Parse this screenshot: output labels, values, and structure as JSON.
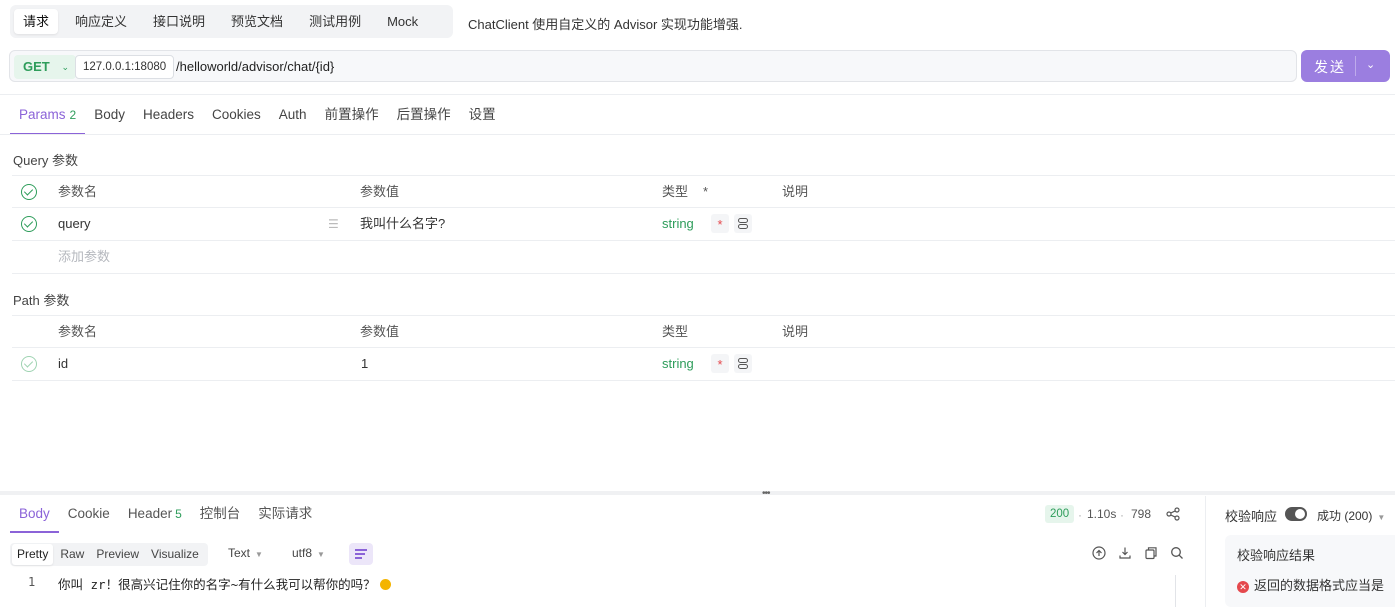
{
  "top_tabs": [
    "请求",
    "响应定义",
    "接口说明",
    "预览文档",
    "测试用例",
    "Mock"
  ],
  "description": "ChatClient 使用自定义的 Advisor 实现功能增强.",
  "request": {
    "method": "GET",
    "host": "127.0.0.1:18080",
    "path": "/helloworld/advisor/chat/{id}",
    "send_label": "发送"
  },
  "sub_tabs": [
    {
      "label": "Params",
      "badge": "2"
    },
    {
      "label": "Body"
    },
    {
      "label": "Headers"
    },
    {
      "label": "Cookies"
    },
    {
      "label": "Auth"
    },
    {
      "label": "前置操作"
    },
    {
      "label": "后置操作"
    },
    {
      "label": "设置"
    }
  ],
  "query": {
    "title": "Query 参数",
    "headers": {
      "name": "参数名",
      "value": "参数值",
      "type": "类型",
      "required": "*",
      "desc": "说明"
    },
    "rows": [
      {
        "name": "query",
        "value": "我叫什么名字?",
        "type": "string"
      }
    ],
    "add_placeholder": "添加参数"
  },
  "path_params": {
    "title": "Path 参数",
    "headers": {
      "name": "参数名",
      "value": "参数值",
      "type": "类型",
      "desc": "说明"
    },
    "rows": [
      {
        "name": "id",
        "value": "1",
        "type": "string"
      }
    ]
  },
  "response": {
    "tabs": [
      {
        "label": "Body"
      },
      {
        "label": "Cookie"
      },
      {
        "label": "Header",
        "badge": "5"
      },
      {
        "label": "控制台"
      },
      {
        "label": "实际请求"
      }
    ],
    "status": "200",
    "time": "1.10s",
    "size": "798",
    "formats": [
      "Pretty",
      "Raw",
      "Preview",
      "Visualize"
    ],
    "content_type": "Text",
    "encoding": "utf8",
    "line_number": "1",
    "body_text": "你叫 zr！很高兴记住你的名字~有什么我可以帮你的吗？"
  },
  "validation": {
    "label": "校验响应",
    "selected": "成功 (200)",
    "result_title": "校验响应结果",
    "error_text": "返回的数据格式应当是"
  },
  "colors": {
    "accent": "#8b63d8",
    "send_button": "#9b7ee0",
    "success": "#2e9d5b",
    "error": "#e5484d"
  }
}
